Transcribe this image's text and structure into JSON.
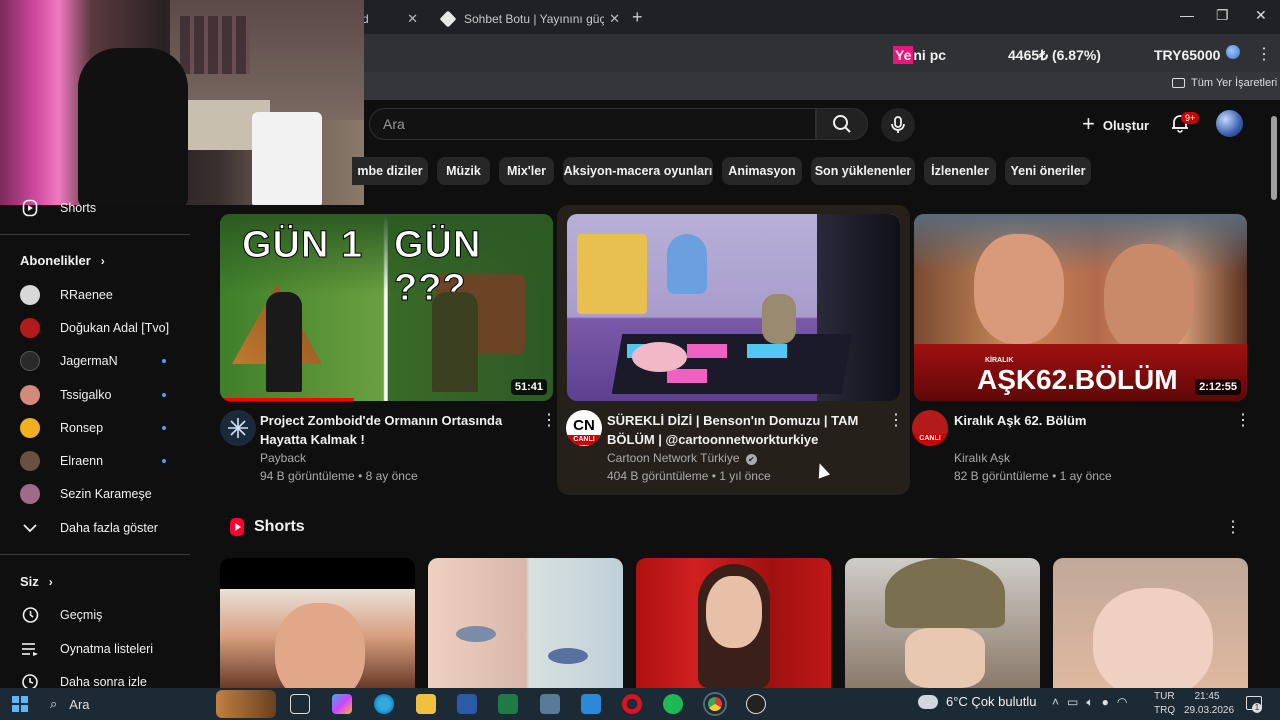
{
  "browser": {
    "tabs": [
      {
        "label": "d",
        "close": "✕"
      },
      {
        "label": "Sohbet Botu | Yayınını güçlendir",
        "close": "✕"
      }
    ],
    "new_tab": "+",
    "window_controls": {
      "minimize": "—",
      "maximize": "❐",
      "close": "✕"
    },
    "ticker": {
      "highlight": "Ye",
      "title_rest": "ni pc",
      "change": "4465₺ (6.87%)",
      "price": "TRY65000"
    },
    "more": "⋮",
    "bookmarks_all": "Tüm Yer İşaretleri"
  },
  "youtube": {
    "search": {
      "placeholder": "Ara"
    },
    "create_label": "Oluştur",
    "notifications_badge": "9+",
    "chips": [
      "mbe diziler",
      "Müzik",
      "Mix'ler",
      "Aksiyon-macera oyunları",
      "Animasyon",
      "Son yüklenenler",
      "İzlenenler",
      "Yeni öneriler"
    ],
    "sidebar": {
      "shorts": "Shorts",
      "subscriptions_title": "Abonelikler",
      "subscriptions": [
        {
          "name": "RRaenee",
          "color": "#d8d8d8",
          "live": false
        },
        {
          "name": "Doğukan Adal [Tvo]",
          "color": "#b31a1a",
          "live": false
        },
        {
          "name": "JagermaN",
          "color": "#2a2a2a",
          "live": true
        },
        {
          "name": "Tssigalko",
          "color": "#d48a7a",
          "live": true
        },
        {
          "name": "Ronsep",
          "color": "#f0b020",
          "live": true
        },
        {
          "name": "Elraenn",
          "color": "#6a5040",
          "live": true
        },
        {
          "name": "Sezin Karameşe",
          "color": "#a06a8a",
          "live": false
        }
      ],
      "show_more": "Daha fazla göster",
      "you_title": "Siz",
      "you_items": [
        "Geçmiş",
        "Oynatma listeleri",
        "Daha sonra izle"
      ]
    },
    "videos": [
      {
        "title": "Project Zomboid'de Ormanın Ortasında Hayatta Kalmak !",
        "channel": "Payback",
        "meta": "94 B görüntüleme • 8 ay önce",
        "duration": "51:41",
        "thumb_text_left": "GÜN 1",
        "thumb_text_right": "GÜN ???",
        "avatar_color": "#1b2a3a"
      },
      {
        "title": "SÜREKLİ DİZİ | Benson'ın Domuzu | TAM BÖLÜM | @cartoonnetworkturkiye",
        "channel": "Cartoon Network Türkiye",
        "meta": "404 B görüntüleme • 1 yıl önce",
        "verified": "✔",
        "avatar_text": "CN",
        "live_label": "CANLI",
        "avatar_color": "#ffffff"
      },
      {
        "title": "Kiralık Aşk 62. Bölüm",
        "channel": "Kiralık Aşk",
        "meta": "82 B görüntüleme • 1 ay önce",
        "duration": "2:12:55",
        "thumb_brand_small": "KİRALIK",
        "thumb_brand": "AŞK",
        "thumb_episode": "62.BÖLÜM",
        "live_label": "CANLI",
        "avatar_color": "#b31a1a"
      }
    ],
    "shorts_title": "Shorts"
  },
  "taskbar": {
    "search": "Ara",
    "weather": "6°C  Çok bulutlu",
    "lang": [
      "TUR",
      "TRQ"
    ],
    "time": "21:45",
    "date": "29.03.2026",
    "notif_count": "1"
  }
}
